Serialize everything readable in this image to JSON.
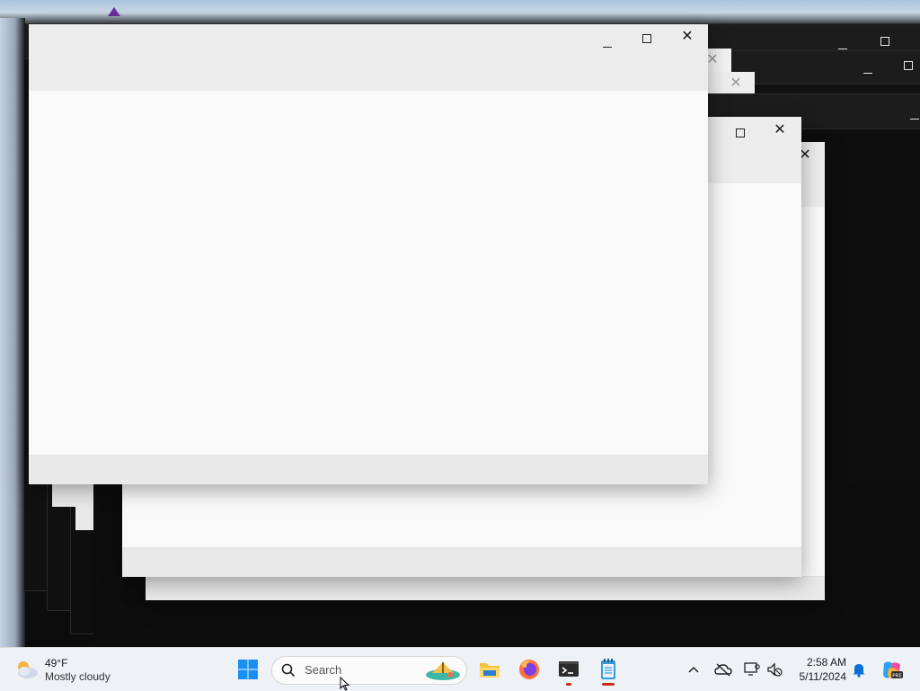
{
  "windows": {
    "main": {
      "minimize_label": "minimize",
      "maximize_label": "maximize",
      "close_label": "close"
    },
    "second": {
      "close_label": "close"
    }
  },
  "taskbar": {
    "weather": {
      "temperature": "49°F",
      "condition": "Mostly cloudy"
    },
    "search": {
      "placeholder": "Search"
    },
    "apps": [
      "file-explorer",
      "firefox",
      "terminal",
      "notepad"
    ],
    "clock": {
      "time": "2:58 AM",
      "date": "5/11/2024"
    },
    "tray": [
      "chevron-up-icon",
      "onedrive-icon",
      "network-icon",
      "volume-muted-icon",
      "notification-bell-icon",
      "copilot-icon"
    ]
  },
  "colors": {
    "taskbar_bg": "#eef1f5",
    "window_bg": "#f9f9f9",
    "title_bg": "#ececec",
    "desktop_dark": "#0c0c0c",
    "accent_blue": "#0a6fd6"
  }
}
